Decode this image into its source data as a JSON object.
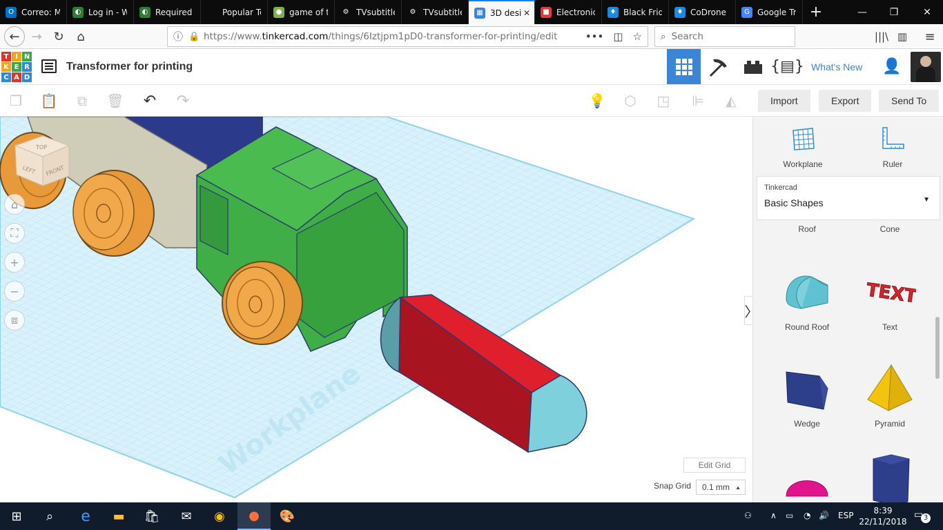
{
  "browser": {
    "tabs": [
      {
        "label": "Correo: M",
        "favicon_color": "#0072c6",
        "favicon_glyph": "O",
        "active": false
      },
      {
        "label": "Log in - W",
        "favicon_color": "#2e7d32",
        "favicon_glyph": "◐",
        "active": false
      },
      {
        "label": "Required I",
        "favicon_color": "#2e7d32",
        "favicon_glyph": "◐",
        "active": false
      },
      {
        "label": "Popular Torren",
        "favicon_color": "#0c0c0d",
        "favicon_glyph": "",
        "active": false
      },
      {
        "label": "game of th",
        "favicon_color": "#7cb342",
        "favicon_glyph": "●",
        "active": false
      },
      {
        "label": "TVsubtitle",
        "favicon_color": "#0c0c0d",
        "favicon_glyph": "⚙",
        "active": false
      },
      {
        "label": "TVsubtitle",
        "favicon_color": "#0c0c0d",
        "favicon_glyph": "⚙",
        "active": false
      },
      {
        "label": "3D desi",
        "favicon_color": "#3a85d6",
        "favicon_glyph": "▦",
        "active": true
      },
      {
        "label": "Electronic",
        "favicon_color": "#e53935",
        "favicon_glyph": "■",
        "active": false
      },
      {
        "label": "Black Frid",
        "favicon_color": "#1e88e5",
        "favicon_glyph": "♦",
        "active": false
      },
      {
        "label": "CoDrone F",
        "favicon_color": "#1e88e5",
        "favicon_glyph": "♦",
        "active": false
      },
      {
        "label": "Google Tra",
        "favicon_color": "#4285f4",
        "favicon_glyph": "G",
        "active": false
      }
    ],
    "close_glyph": "✕",
    "new_tab_glyph": "+",
    "url_host_prefix": "https://www.",
    "url_host": "tinkercad.com",
    "url_path": "/things/6Iztjpm1pD0-transformer-for-printing/edit",
    "search_placeholder": "Search"
  },
  "app": {
    "logo_letters": [
      "T",
      "I",
      "N",
      "K",
      "E",
      "R",
      "C",
      "A",
      "D"
    ],
    "title": "Transformer for printing",
    "whats_new": "What's New",
    "colors": {
      "accent": "#3a85d6",
      "logo_red": "#e2332a",
      "logo_orange": "#f6a41d",
      "logo_green": "#3aa845",
      "logo_blue": "#2e8ad8"
    }
  },
  "toolbar": {
    "import_label": "Import",
    "export_label": "Export",
    "send_to_label": "Send To"
  },
  "workspace": {
    "workplane_label": "Workplane",
    "view_cube_top": "TOP",
    "view_cube_left": "LEFT",
    "view_cube_front": "FRONT",
    "edit_grid_label": "Edit Grid",
    "snap_grid_label": "Snap Grid",
    "snap_grid_value": "0.1 mm"
  },
  "panel": {
    "workplane_tool": "Workplane",
    "ruler_tool": "Ruler",
    "library_label": "Tinkercad",
    "category": "Basic Shapes",
    "partial_labels": [
      "Roof",
      "Cone"
    ],
    "shapes": [
      {
        "label": "Round Roof",
        "color": "#5ec2d0"
      },
      {
        "label": "Text",
        "color": "#d8232a"
      },
      {
        "label": "Wedge",
        "color": "#2d3e8a"
      },
      {
        "label": "Pyramid",
        "color": "#f2c40f"
      }
    ],
    "partial_bottom": [
      {
        "color": "#e0148c"
      },
      {
        "color": "#2d3e8a"
      }
    ]
  },
  "taskbar": {
    "time": "8:39",
    "date": "22/11/2018",
    "language": "ESP",
    "notification_count": "3"
  }
}
